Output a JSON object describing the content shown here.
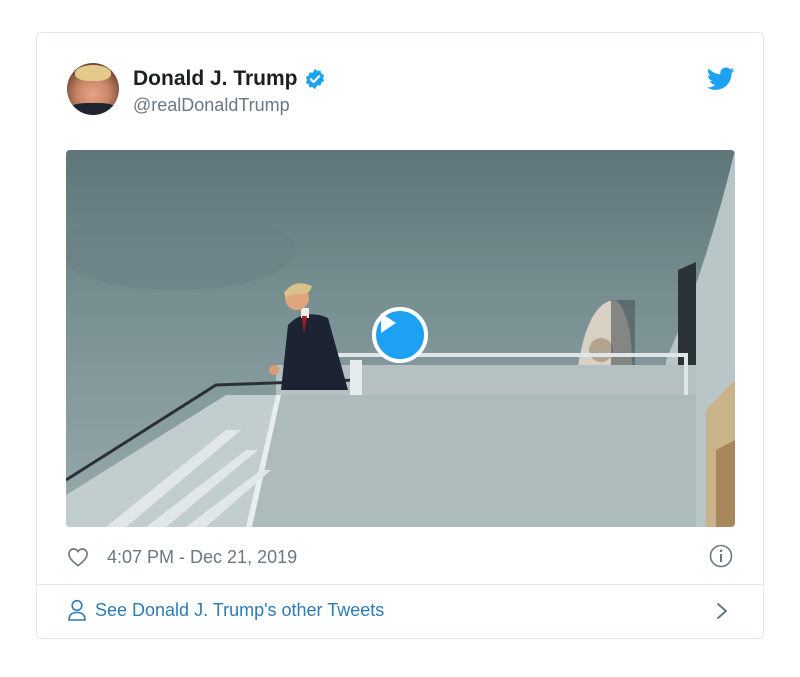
{
  "tweet": {
    "author_name": "Donald J. Trump",
    "handle": "@realDonaldTrump",
    "timestamp": "4:07 PM - Dec 21, 2019"
  },
  "footer": {
    "other_tweets_label": "See Donald J. Trump's other Tweets"
  },
  "colors": {
    "accent": "#1da1f2",
    "link": "#2b7bb9",
    "secondary_text": "#697882",
    "border": "#e1e8ed"
  },
  "icons": {
    "verified": "verified-badge-icon",
    "brand": "twitter-bird-icon",
    "like": "heart-icon",
    "info": "info-icon",
    "person": "person-icon",
    "chevron": "chevron-right-icon",
    "play": "play-icon"
  }
}
